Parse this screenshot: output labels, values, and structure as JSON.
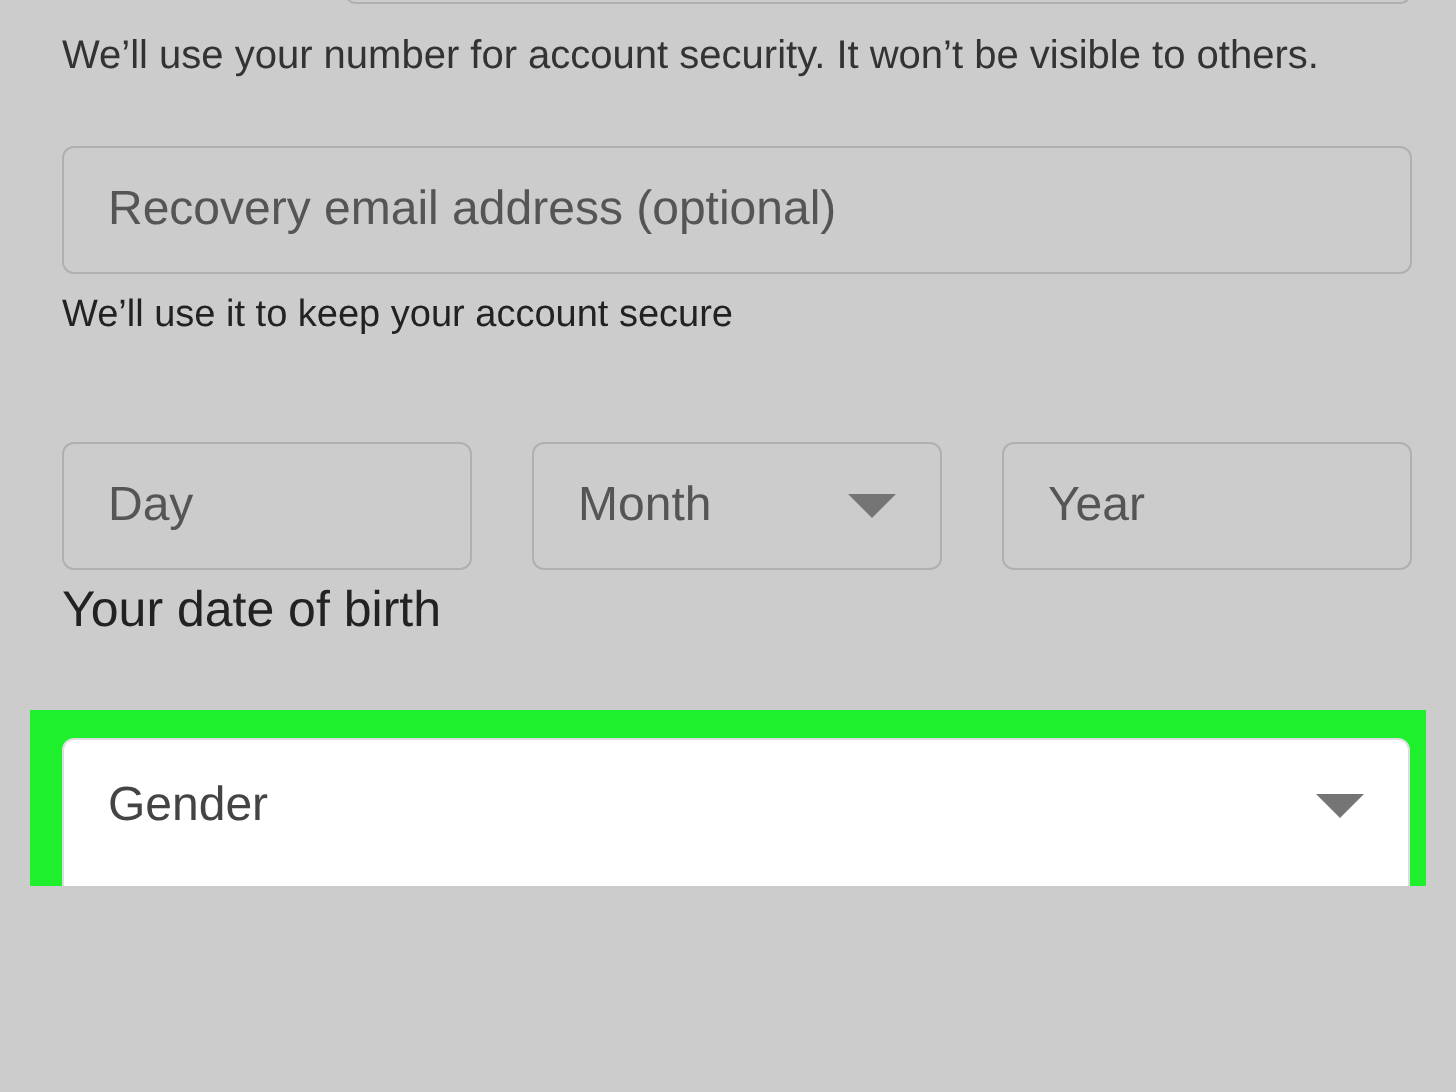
{
  "phone_hint": "We’ll use your number for account security. It won’t be visible to others.",
  "recovery_email": {
    "placeholder": "Recovery email address (optional)"
  },
  "recovery_hint": "We’ll use it to keep your account secure",
  "birth_date": {
    "fields": [
      {
        "placeholder": "Day",
        "kind": "text"
      },
      {
        "placeholder": "Month",
        "kind": "select"
      },
      {
        "placeholder": "Year",
        "kind": "text"
      }
    ],
    "label": "Your date of birth"
  },
  "gender": {
    "placeholder": "Gender",
    "highlighted": true
  }
}
